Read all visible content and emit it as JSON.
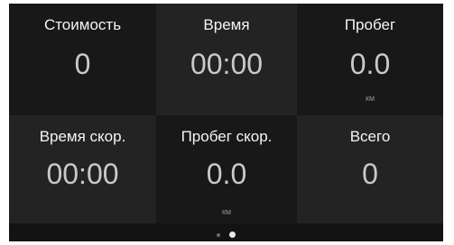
{
  "tiles": [
    {
      "label": "Стоимость",
      "value": "0",
      "unit": ""
    },
    {
      "label": "Время",
      "value": "00:00",
      "unit": ""
    },
    {
      "label": "Пробег",
      "value": "0.0",
      "unit": "км"
    },
    {
      "label": "Время скор.",
      "value": "00:00",
      "unit": ""
    },
    {
      "label": "Пробег скор.",
      "value": "0.0",
      "unit": "км"
    },
    {
      "label": "Всего",
      "value": "0",
      "unit": ""
    }
  ],
  "pager": {
    "pages": 2,
    "active_page": 2
  },
  "colors": {
    "background": "#131313",
    "tile_dark": "#181818",
    "tile_light": "#232323",
    "label_text": "#f4f4f4",
    "value_text": "#c9c9c9",
    "unit_text": "#8c8c8c"
  }
}
